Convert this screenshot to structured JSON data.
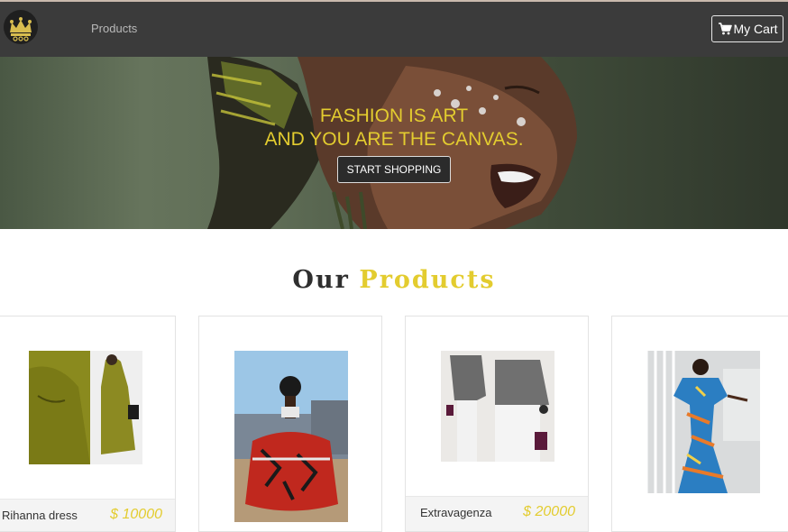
{
  "navbar": {
    "nav_link": "Products",
    "cart_label": "My Cart",
    "logo_icon": "crown-icon",
    "cart_icon": "cart-icon"
  },
  "hero": {
    "line1": "FASHION IS ART",
    "line2": "AND YOU ARE THE CANVAS.",
    "button_label": "START SHOPPING"
  },
  "section": {
    "word1": "Our",
    "word2": "Products"
  },
  "products": [
    {
      "name": "Rihanna dress",
      "price": "$ 10000"
    },
    {
      "name": "",
      "price": ""
    },
    {
      "name": "Extravagenza",
      "price": "$ 20000"
    },
    {
      "name": "",
      "price": ""
    }
  ],
  "colors": {
    "accent": "#e3cc2f",
    "navbar": "#3b3b3b",
    "title_dark": "#2f2f2f"
  }
}
